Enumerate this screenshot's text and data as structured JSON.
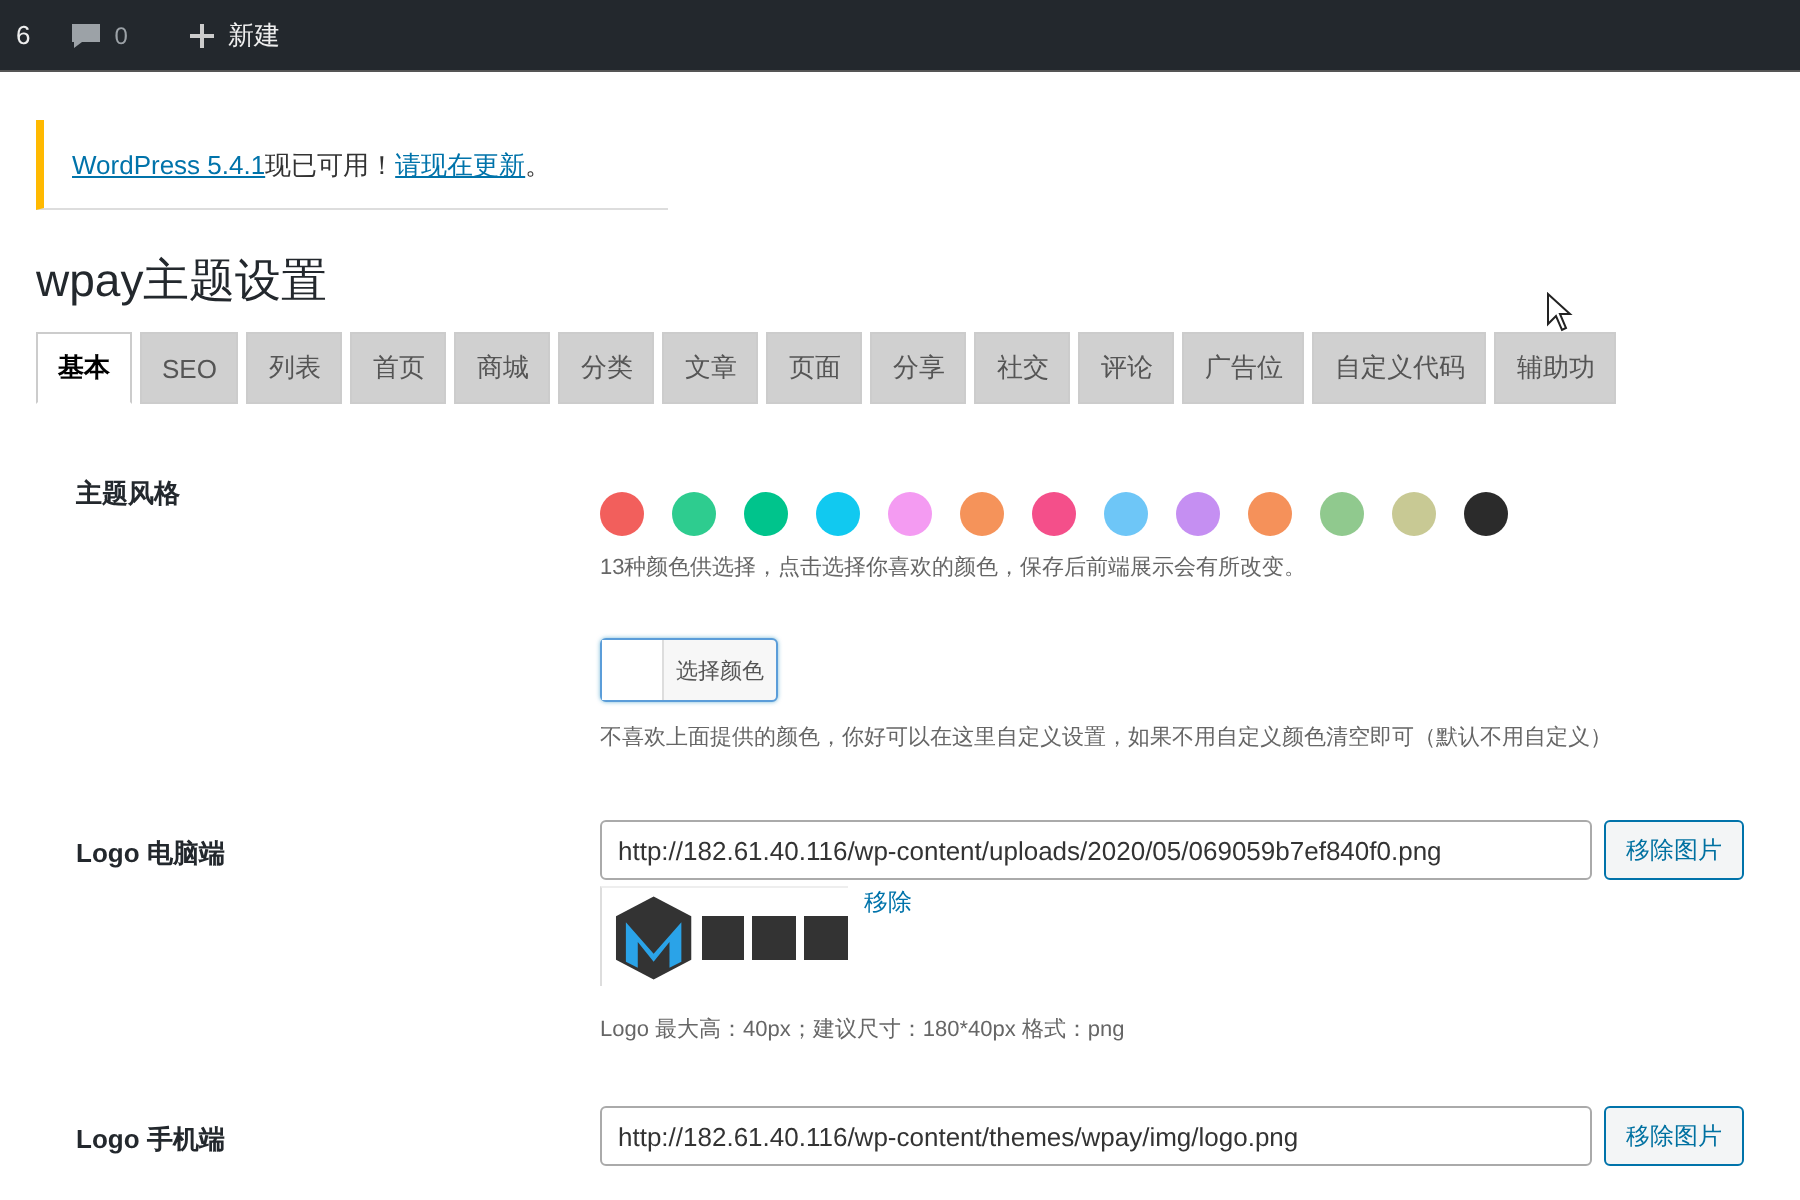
{
  "admin_bar": {
    "updates": "6",
    "comments": "0",
    "new_label": "新建"
  },
  "notice": {
    "link": "WordPress 5.4.1",
    "text": "现已可用！",
    "action": "请现在更新",
    "end": "。"
  },
  "page_title": "wpay主题设置",
  "tabs": [
    {
      "label": "基本",
      "selected": true
    },
    {
      "label": "SEO",
      "selected": false
    },
    {
      "label": "列表",
      "selected": false
    },
    {
      "label": "首页",
      "selected": false
    },
    {
      "label": "商城",
      "selected": false
    },
    {
      "label": "分类",
      "selected": false
    },
    {
      "label": "文章",
      "selected": false
    },
    {
      "label": "页面",
      "selected": false
    },
    {
      "label": "分享",
      "selected": false
    },
    {
      "label": "社交",
      "selected": false
    },
    {
      "label": "评论",
      "selected": false
    },
    {
      "label": "广告位",
      "selected": false
    },
    {
      "label": "自定义代码",
      "selected": false
    },
    {
      "label": "辅助功",
      "selected": false
    }
  ],
  "theme_style": {
    "label": "主题风格",
    "swatches": [
      {
        "color": "#f25f5c"
      },
      {
        "color": "#2ecc8f"
      },
      {
        "color": "#00c48c"
      },
      {
        "color": "#11c9f0"
      },
      {
        "color": "#f49bf2"
      },
      {
        "color": "#f5935a"
      },
      {
        "color": "#f44f8a"
      },
      {
        "color": "#6ec6f7"
      },
      {
        "color": "#c58ff2"
      },
      {
        "color": "#f5915a"
      },
      {
        "color": "#90c98e"
      },
      {
        "color": "#c8c994"
      },
      {
        "color": "#2b2b2b"
      }
    ],
    "hint": "13种颜色供选择，点击选择你喜欢的颜色，保存后前端展示会有所改变。",
    "picker_label": "选择颜色",
    "picker_hint": "不喜欢上面提供的颜色，你好可以在这里自定义设置，如果不用自定义颜色清空即可（默认不用自定义）"
  },
  "logo_desktop": {
    "label": "Logo 电脑端",
    "value": "http://182.61.40.116/wp-content/uploads/2020/05/069059b7ef840f0.png",
    "button": "移除图片",
    "remove_link": "移除",
    "hint": "Logo 最大高：40px；建议尺寸：180*40px 格式：png"
  },
  "logo_mobile": {
    "label": "Logo 手机端",
    "value": "http://182.61.40.116/wp-content/themes/wpay/img/logo.png",
    "button": "移除图片"
  }
}
